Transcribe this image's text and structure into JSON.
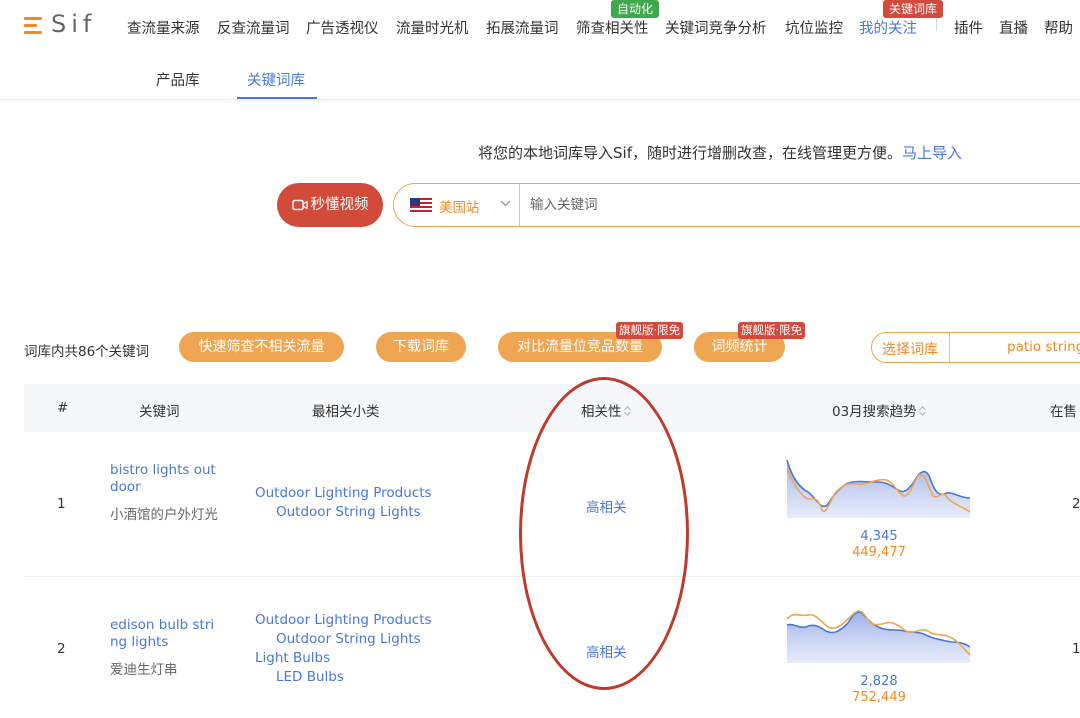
{
  "brand": {
    "name": "Sif",
    "accent": "#f08a24",
    "link_color": "#4a78d6"
  },
  "nav": {
    "items": [
      "查流量来源",
      "反查流量词",
      "广告透视仪",
      "流量时光机",
      "拓展流量词",
      "筛查相关性",
      "关键词竞争分析",
      "坑位监控",
      "我的关注",
      "插件",
      "直播",
      "帮助"
    ],
    "active": "我的关注",
    "badge_green": "自动化",
    "badge_red": "关键词库"
  },
  "subtabs": {
    "items": [
      "产品库",
      "关键词库"
    ],
    "active": "关键词库"
  },
  "import": {
    "text": "将您的本地词库导入Sif，随时进行增删改查，在线管理更方便。",
    "link": "马上导入"
  },
  "search": {
    "video_button": "秒懂视频",
    "site": "美国站",
    "placeholder": "输入关键词",
    "flag_icon": "us-flag-icon"
  },
  "toolbar": {
    "count_text": "词库内共86个关键词",
    "buttons": [
      "快速筛查不相关流量",
      "下载词库",
      "对比流量位竞品数量",
      "词频统计"
    ],
    "premium_tag": "旗舰版·限免",
    "library_label": "选择词库",
    "library_value": "patio string"
  },
  "table": {
    "headers": [
      "#",
      "关键词",
      "最相关小类",
      "相关性",
      "03月搜索趋势",
      "在售"
    ],
    "rows": [
      {
        "index": "1",
        "keyword_en": "bistro lights outdoor",
        "keyword_cn": "小酒馆的户外灯光",
        "categories": [
          {
            "parent": "Outdoor Lighting Products",
            "child": "Outdoor String Lights"
          }
        ],
        "relevance": "高相关",
        "trend_value_blue": "4,345",
        "trend_value_orange": "449,477",
        "on_sale": "2"
      },
      {
        "index": "2",
        "keyword_en": "edison bulb string lights",
        "keyword_cn": "爱迪生灯串",
        "categories": [
          {
            "parent": "Outdoor Lighting Products",
            "child": "Outdoor String Lights"
          },
          {
            "parent": "Light Bulbs",
            "child": "LED Bulbs"
          }
        ],
        "relevance": "高相关",
        "trend_value_blue": "2,828",
        "trend_value_orange": "752,449",
        "on_sale": "1"
      }
    ]
  },
  "colors": {
    "orange_button": "#f0a552",
    "red_button": "#d14a3a",
    "annotation": "#c0392b"
  }
}
